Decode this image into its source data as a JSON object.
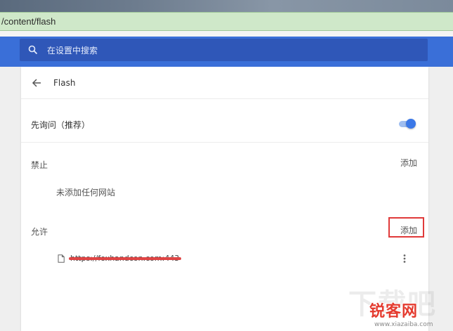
{
  "address_bar": {
    "url": "/content/flash"
  },
  "header": {
    "search_placeholder": "在设置中搜索"
  },
  "page": {
    "title": "Flash",
    "ask_first_label": "先询问（推荐）",
    "block_section": {
      "label": "禁止",
      "add_label": "添加",
      "empty_text": "未添加任何网站"
    },
    "allow_section": {
      "label": "允许",
      "add_label": "添加",
      "site": "https://foxhandcon.com:443"
    }
  },
  "watermark": {
    "brand": "锐客网",
    "url": "www.xiazaiba.com",
    "faint": "下载吧"
  },
  "colors": {
    "header_blue": "#3a6fd8",
    "search_box_blue": "#2f57b8",
    "toggle_blue": "#3b78e7",
    "highlight_red": "#e03a3a",
    "address_bar_green": "#cfe8c9"
  },
  "icons": {
    "search": "search-icon",
    "back": "arrow-left-icon",
    "file": "file-icon",
    "more": "more-vert-icon"
  }
}
